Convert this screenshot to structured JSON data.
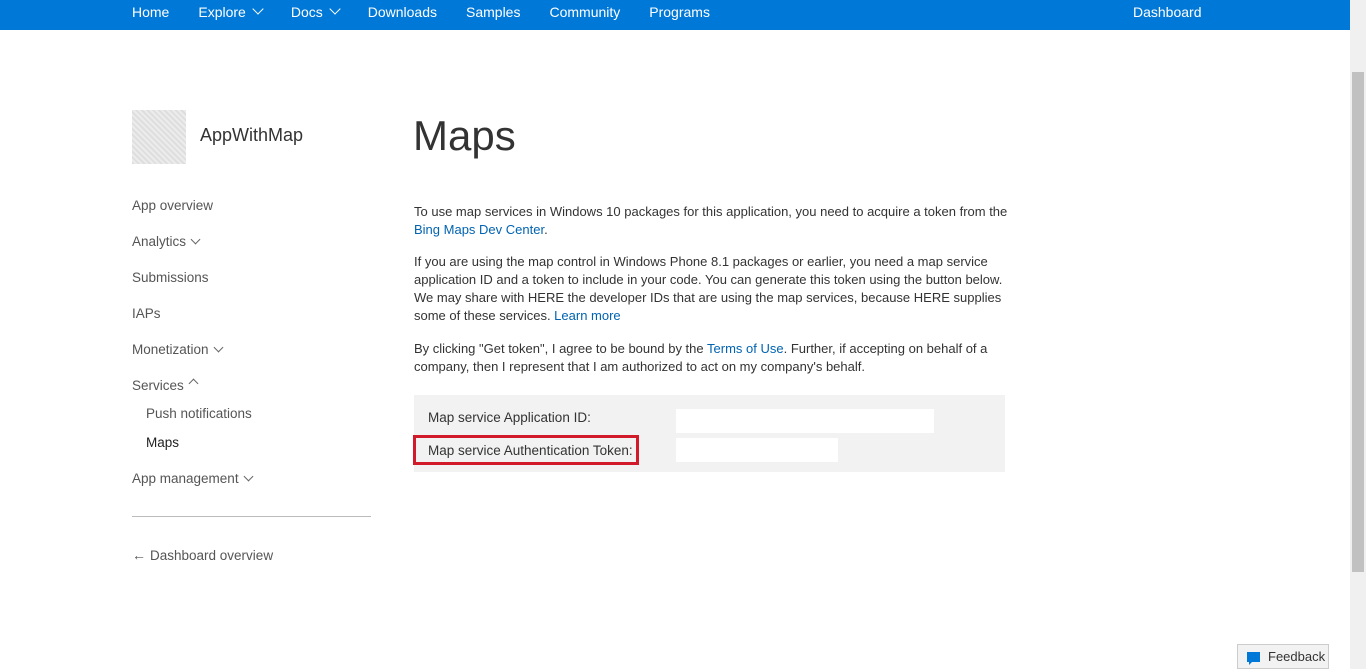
{
  "nav": {
    "items": [
      {
        "label": "Home",
        "has_chevron": false
      },
      {
        "label": "Explore",
        "has_chevron": true
      },
      {
        "label": "Docs",
        "has_chevron": true
      },
      {
        "label": "Downloads",
        "has_chevron": false
      },
      {
        "label": "Samples",
        "has_chevron": false
      },
      {
        "label": "Community",
        "has_chevron": false
      },
      {
        "label": "Programs",
        "has_chevron": false
      }
    ],
    "right_label": "Dashboard",
    "color": "#0078d7"
  },
  "sidebar": {
    "app_name": "AppWithMap",
    "items": [
      {
        "label": "App overview"
      },
      {
        "label": "Analytics"
      },
      {
        "label": "Submissions"
      },
      {
        "label": "IAPs"
      },
      {
        "label": "Monetization"
      },
      {
        "label": "Services"
      },
      {
        "label": "App management"
      }
    ],
    "services_sub": [
      {
        "label": "Push notifications"
      },
      {
        "label": "Maps"
      }
    ],
    "back_label": "Dashboard overview"
  },
  "main": {
    "title": "Maps",
    "p1": {
      "text": "To use map services in Windows 10 packages for this application, you need to acquire a token from the ",
      "link": "Bing Maps Dev Center",
      "end": "."
    },
    "p2": {
      "text": "If you are using the map control in Windows Phone 8.1 packages or earlier, you need a map service application ID and a token to include in your code. You can generate this token using the button below. We may share with HERE the developer IDs that are using the map services, because HERE supplies some of these services. ",
      "link": "Learn more"
    },
    "p3": {
      "text": "By clicking \"Get token\", I agree to be bound by the ",
      "link": "Terms of Use",
      "end": ". Further, if accepting on behalf of a company, then I represent that I am authorized to act on my company's behalf."
    },
    "fields": {
      "app_id_label": "Map service Application ID:",
      "token_label": "Map service Authentication Token:",
      "app_id_value": "",
      "token_value": ""
    },
    "highlight_color": "#d11a2a"
  },
  "feedback": {
    "label": "Feedback"
  }
}
